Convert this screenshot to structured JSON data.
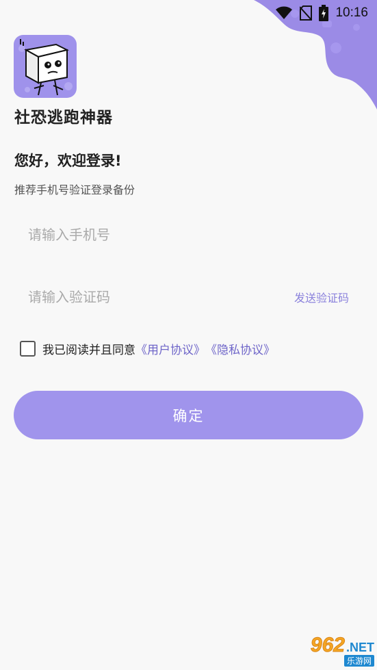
{
  "status_bar": {
    "time": "10:16",
    "icons": [
      "wifi-icon",
      "no-sim-icon",
      "battery-charging-icon"
    ]
  },
  "app": {
    "name": "社恐逃跑神器",
    "logo_icon": "box-character-logo"
  },
  "login": {
    "greeting": "您好，欢迎登录!",
    "subtitle": "推荐手机号验证登录备份",
    "phone_placeholder": "请输入手机号",
    "code_placeholder": "请输入验证码",
    "send_code_label": "发送验证码",
    "agree_text": "我已阅读并且同意",
    "user_agreement": "《用户协议》",
    "privacy_agreement": "《隐私协议》",
    "confirm_label": "确定"
  },
  "watermark": {
    "number": "962",
    "suffix": ".NET",
    "caption": "乐游网"
  },
  "colors": {
    "accent": "#a094ec",
    "link": "#6f66c9",
    "send_code": "#8b82dc",
    "background": "#f8f8f8"
  }
}
